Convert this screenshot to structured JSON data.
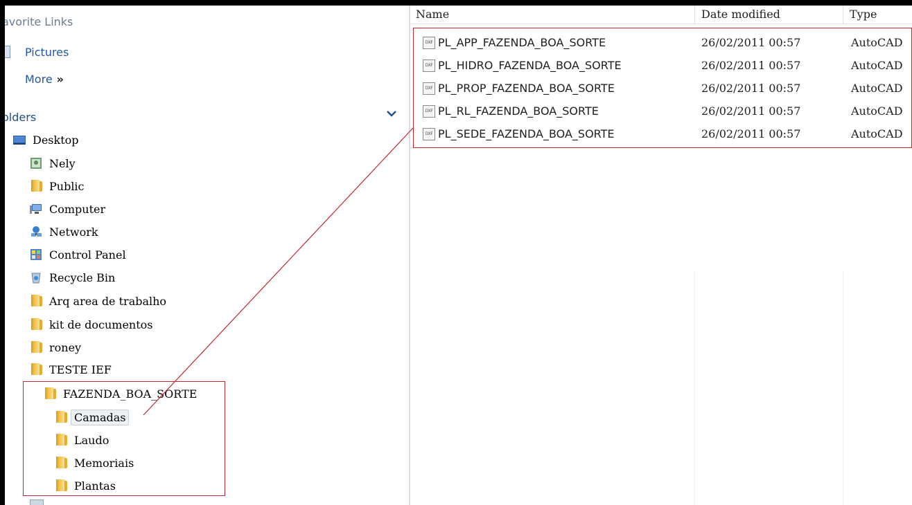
{
  "nav": {
    "favorites_header": "avorite Links",
    "favorites": [
      {
        "label": "Pictures",
        "icon": "pictures-icon"
      },
      {
        "label": "More",
        "icon": "none"
      }
    ],
    "more_arrows": "»",
    "folders_header": "olders",
    "tree": [
      {
        "label": "Desktop",
        "icon": "desktop-icon"
      },
      {
        "label": "Nely",
        "icon": "user-folder-icon"
      },
      {
        "label": "Public",
        "icon": "folder-icon"
      },
      {
        "label": "Computer",
        "icon": "computer-icon"
      },
      {
        "label": "Network",
        "icon": "network-icon"
      },
      {
        "label": "Control Panel",
        "icon": "control-panel-icon"
      },
      {
        "label": "Recycle Bin",
        "icon": "recycle-bin-icon"
      },
      {
        "label": "Arq area de trabalho",
        "icon": "folder-icon"
      },
      {
        "label": "kit de documentos",
        "icon": "folder-icon"
      },
      {
        "label": "roney",
        "icon": "folder-icon"
      },
      {
        "label": "TESTE IEF",
        "icon": "folder-icon"
      },
      {
        "label": "FAZENDA_BOA_SORTE",
        "icon": "folder-icon"
      },
      {
        "label": "Camadas",
        "icon": "folder-icon",
        "selected": true
      },
      {
        "label": "Laudo",
        "icon": "folder-icon"
      },
      {
        "label": "Memoriais",
        "icon": "folder-icon"
      },
      {
        "label": "Plantas",
        "icon": "folder-icon"
      }
    ]
  },
  "files": {
    "columns": [
      "Name",
      "Date modified",
      "Type"
    ],
    "rows": [
      {
        "name": "PL_APP_FAZENDA_BOA_SORTE",
        "date": "26/02/2011 00:57",
        "type": "AutoCAD"
      },
      {
        "name": "PL_HIDRO_FAZENDA_BOA_SORTE",
        "date": "26/02/2011 00:57",
        "type": "AutoCAD"
      },
      {
        "name": "PL_PROP_FAZENDA_BOA_SORTE",
        "date": "26/02/2011 00:57",
        "type": "AutoCAD"
      },
      {
        "name": "PL_RL_FAZENDA_BOA_SORTE",
        "date": "26/02/2011 00:57",
        "type": "AutoCAD"
      },
      {
        "name": "PL_SEDE_FAZENDA_BOA_SORTE",
        "date": "26/02/2011 00:57",
        "type": "AutoCAD"
      }
    ],
    "file_icon_text": "DXF"
  },
  "colors": {
    "highlight": "#c4272e",
    "link": "#1f57a6",
    "folder": "#f2c14e"
  }
}
